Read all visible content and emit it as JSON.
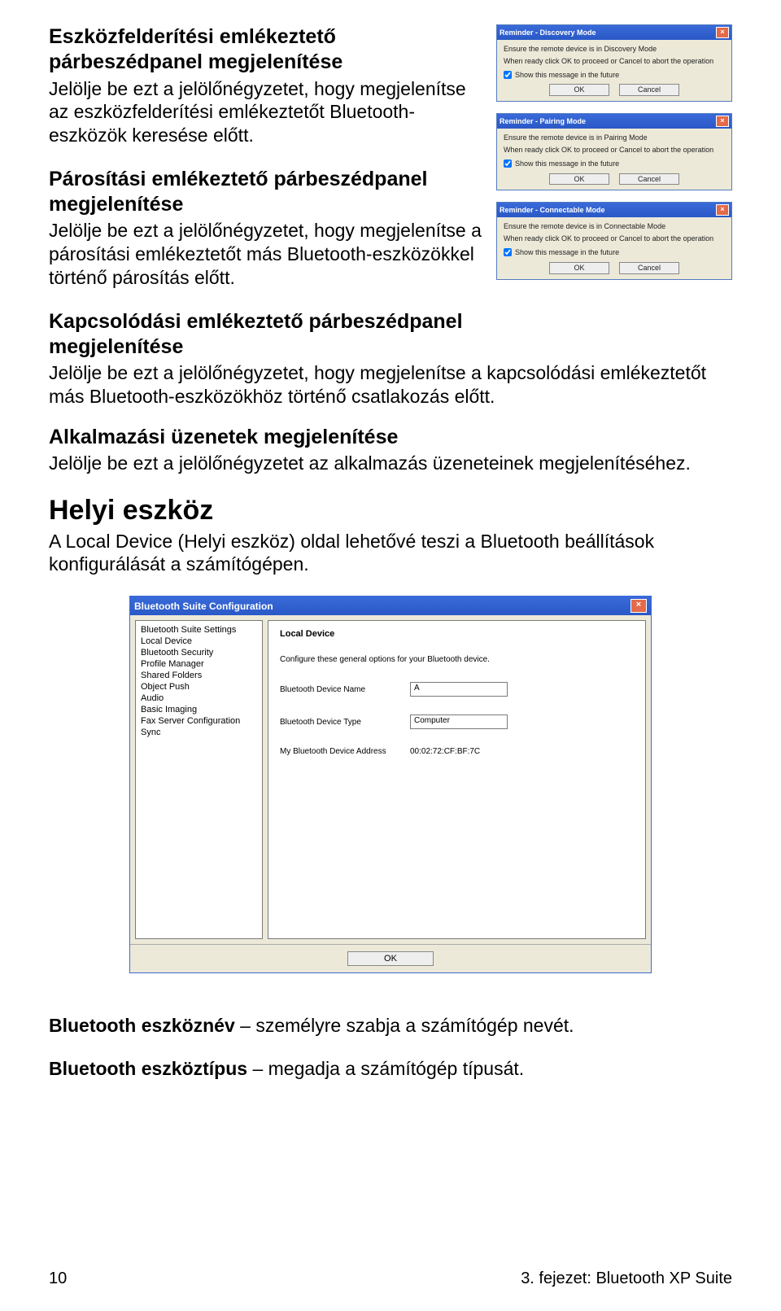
{
  "sections": {
    "s1": {
      "title": "Eszközfelderítési emlékeztető párbeszédpanel megjelenítése",
      "body": "Jelölje be ezt a jelölőnégyzetet, hogy megjelenítse az eszközfelderítési emlékeztetőt Bluetooth-eszközök keresése előtt."
    },
    "s2": {
      "title": "Párosítási emlékeztető párbeszédpanel megjelenítése",
      "body": "Jelölje be ezt a jelölőnégyzetet, hogy megjelenítse a párosítási emlékeztetőt más Bluetooth-eszközökkel történő párosítás előtt."
    },
    "s3": {
      "title": "Kapcsolódási emlékeztető párbeszédpanel megjelenítése",
      "body": "Jelölje be ezt a jelölőnégyzetet, hogy megjelenítse a kapcsolódási emlékeztetőt más Bluetooth-eszközökhöz történő csatlakozás előtt."
    },
    "s4": {
      "title": "Alkalmazási üzenetek megjelenítése",
      "body": "Jelölje be ezt a jelölőnégyzetet az alkalmazás üzeneteinek megjelenítéséhez."
    }
  },
  "heading_big": "Helyi eszköz",
  "heading_big_body": "A Local Device (Helyi eszköz) oldal lehetővé teszi a Bluetooth beállítások konfigurálását a számítógépen.",
  "line_devname_b": "Bluetooth eszköznév",
  "line_devname_t": " – személyre szabja a számítógép nevét.",
  "line_devtype_b": "Bluetooth eszköztípus",
  "line_devtype_t": " – megadja a számítógép típusát.",
  "reminders": [
    {
      "title": "Reminder - Discovery Mode",
      "l1": "Ensure the remote device is in  Discovery Mode",
      "l2": "When ready click OK to proceed or Cancel to abort the operation",
      "chk": "Show this message in the future",
      "ok": "OK",
      "cancel": "Cancel"
    },
    {
      "title": "Reminder - Pairing Mode",
      "l1": "Ensure the remote device is in  Pairing Mode",
      "l2": "When ready click OK to proceed or Cancel to abort the operation",
      "chk": "Show this message in the future",
      "ok": "OK",
      "cancel": "Cancel"
    },
    {
      "title": "Reminder - Connectable Mode",
      "l1": "Ensure the remote device is in  Connectable Mode",
      "l2": "When ready click OK to proceed or Cancel to abort the operation",
      "chk": "Show this message in the future",
      "ok": "OK",
      "cancel": "Cancel"
    }
  ],
  "config": {
    "title": "Bluetooth Suite Configuration",
    "sidebar": [
      "Bluetooth Suite Settings",
      "Local Device",
      "Bluetooth Security",
      "Profile Manager",
      "Shared Folders",
      "Object Push",
      "Audio",
      "Basic Imaging",
      "Fax Server Configuration",
      "Sync"
    ],
    "main_title": "Local Device",
    "desc": "Configure these general options for your Bluetooth device.",
    "rows": {
      "r1": {
        "label": "Bluetooth Device Name",
        "value": "A"
      },
      "r2": {
        "label": "Bluetooth Device Type",
        "value": "Computer"
      },
      "r3": {
        "label": "My Bluetooth Device Address",
        "value": "00:02:72:CF:BF:7C"
      }
    },
    "ok": "OK"
  },
  "footer": {
    "left": "10",
    "right": "3. fejezet: Bluetooth XP Suite"
  }
}
